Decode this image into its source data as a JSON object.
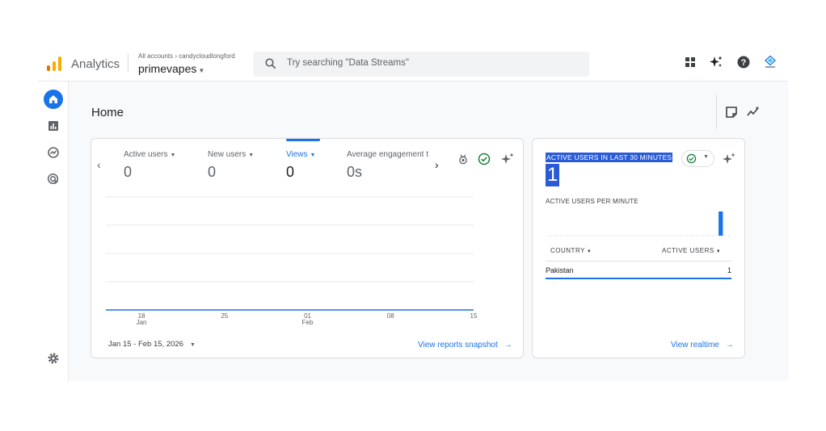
{
  "header": {
    "app_name": "Analytics",
    "breadcrumb_all": "All accounts",
    "breadcrumb_sep": "›",
    "account": "candycloudlongford",
    "property": "primevapes",
    "search_placeholder": "Try searching \"Data Streams\"",
    "icons": [
      "apps-grid-icon",
      "sparkle-icon",
      "help-icon",
      "account-avatar"
    ]
  },
  "sidebar": {
    "items": [
      {
        "name": "home",
        "icon": "home-icon",
        "active": true
      },
      {
        "name": "reports",
        "icon": "bar-chart-icon"
      },
      {
        "name": "explore",
        "icon": "explore-icon"
      },
      {
        "name": "advertising",
        "icon": "advertising-icon"
      },
      {
        "name": "admin",
        "icon": "gear-icon"
      }
    ]
  },
  "page": {
    "title": "Home"
  },
  "overview": {
    "metrics": [
      {
        "label": "Active users",
        "value": "0"
      },
      {
        "label": "New users",
        "value": "0"
      },
      {
        "label": "Views",
        "value": "0",
        "active": true
      },
      {
        "label": "Average engagement t",
        "value": "0s"
      }
    ],
    "x_labels": [
      {
        "day": "18",
        "month": "Jan"
      },
      {
        "day": "25",
        "month": ""
      },
      {
        "day": "01",
        "month": "Feb"
      },
      {
        "day": "08",
        "month": ""
      },
      {
        "day": "15",
        "month": ""
      }
    ],
    "date_range": "Jan 15 - Feb 15, 2026",
    "link": "View reports snapshot",
    "arrow": "→"
  },
  "realtime": {
    "title": "ACTIVE USERS IN LAST 30 MINUTES",
    "value": "1",
    "subtitle": "ACTIVE USERS PER MINUTE",
    "col_country": "COUNTRY",
    "col_users": "ACTIVE USERS",
    "rows": [
      {
        "country": "Pakistan",
        "users": "1"
      }
    ],
    "link": "View realtime",
    "arrow": "→"
  },
  "chart_data": {
    "type": "line",
    "x": [
      "Jan 15",
      "Jan 16",
      "Jan 17",
      "Jan 18",
      "Jan 19",
      "Jan 20",
      "Jan 21",
      "Jan 22",
      "Jan 23",
      "Jan 24",
      "Jan 25",
      "Jan 26",
      "Jan 27",
      "Jan 28",
      "Jan 29",
      "Jan 30",
      "Jan 31",
      "Feb 01",
      "Feb 02",
      "Feb 03",
      "Feb 04",
      "Feb 05",
      "Feb 06",
      "Feb 07",
      "Feb 08",
      "Feb 09",
      "Feb 10",
      "Feb 11",
      "Feb 12",
      "Feb 13",
      "Feb 14",
      "Feb 15"
    ],
    "series": [
      {
        "values": [
          0,
          0,
          0,
          0,
          0,
          0,
          0,
          0,
          0,
          0,
          0,
          0,
          0,
          0,
          0,
          0,
          0,
          0,
          0,
          0,
          0,
          0,
          0,
          0,
          0,
          0,
          0,
          0,
          0,
          0,
          0,
          0
        ]
      }
    ],
    "grid": true,
    "realtime_per_minute": {
      "type": "bar",
      "values": [
        0,
        0,
        0,
        0,
        0,
        0,
        0,
        0,
        0,
        0,
        0,
        0,
        0,
        0,
        0,
        0,
        0,
        0,
        0,
        0,
        0,
        0,
        0,
        0,
        0,
        0,
        0,
        0,
        1,
        0
      ]
    }
  },
  "colors": {
    "accent": "#1a73e8",
    "highlight": "#2a5bd7",
    "logo_orange": "#f9ab00",
    "logo_dark": "#e37400"
  }
}
